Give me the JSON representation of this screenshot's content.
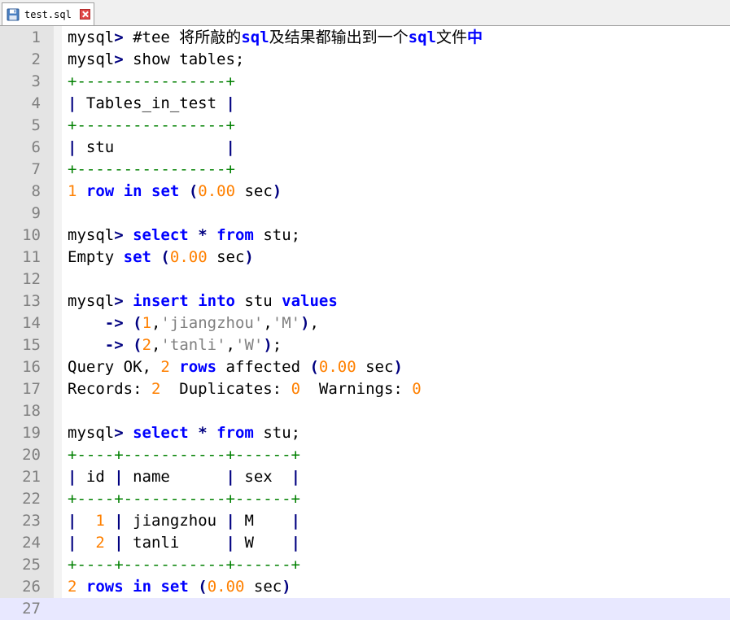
{
  "tab": {
    "filename": "test.sql",
    "icon": "save-disk-icon",
    "close_icon": "close-icon"
  },
  "colors": {
    "keyword": "#0000ff",
    "number": "#ff8000",
    "string": "#808080",
    "border": "#008000",
    "operator": "#000080"
  },
  "editor": {
    "current_line": 27,
    "lines": [
      {
        "n": "1",
        "tokens": [
          {
            "t": "mysql"
          },
          {
            "t": ">",
            "c": "op"
          },
          {
            "t": " #tee "
          },
          {
            "t": "将所敲的",
            "c": "cm"
          },
          {
            "t": "sql",
            "c": "kw"
          },
          {
            "t": "及结果都输出到一个",
            "c": "cm"
          },
          {
            "t": "sql",
            "c": "kw"
          },
          {
            "t": "文件",
            "c": "cm"
          },
          {
            "t": "中",
            "c": "cm kw"
          }
        ]
      },
      {
        "n": "2",
        "tokens": [
          {
            "t": "mysql"
          },
          {
            "t": ">",
            "c": "op"
          },
          {
            "t": " show tables;"
          }
        ]
      },
      {
        "n": "3",
        "tokens": [
          {
            "t": "+----------------+",
            "c": "bd"
          }
        ]
      },
      {
        "n": "4",
        "tokens": [
          {
            "t": "|",
            "c": "op"
          },
          {
            "t": " Tables_in_test "
          },
          {
            "t": "|",
            "c": "op"
          }
        ]
      },
      {
        "n": "5",
        "tokens": [
          {
            "t": "+----------------+",
            "c": "bd"
          }
        ]
      },
      {
        "n": "6",
        "tokens": [
          {
            "t": "|",
            "c": "op"
          },
          {
            "t": " stu            "
          },
          {
            "t": "|",
            "c": "op"
          }
        ]
      },
      {
        "n": "7",
        "tokens": [
          {
            "t": "+----------------+",
            "c": "bd"
          }
        ]
      },
      {
        "n": "8",
        "tokens": [
          {
            "t": "1",
            "c": "num"
          },
          {
            "t": " "
          },
          {
            "t": "row",
            "c": "kw"
          },
          {
            "t": " "
          },
          {
            "t": "in",
            "c": "kw"
          },
          {
            "t": " "
          },
          {
            "t": "set",
            "c": "kw"
          },
          {
            "t": " "
          },
          {
            "t": "(",
            "c": "op"
          },
          {
            "t": "0.00",
            "c": "num"
          },
          {
            "t": " sec"
          },
          {
            "t": ")",
            "c": "op"
          }
        ]
      },
      {
        "n": "9",
        "tokens": []
      },
      {
        "n": "10",
        "tokens": [
          {
            "t": "mysql"
          },
          {
            "t": ">",
            "c": "op"
          },
          {
            "t": " "
          },
          {
            "t": "select",
            "c": "kw"
          },
          {
            "t": " "
          },
          {
            "t": "*",
            "c": "op"
          },
          {
            "t": " "
          },
          {
            "t": "from",
            "c": "kw"
          },
          {
            "t": " stu;"
          }
        ]
      },
      {
        "n": "11",
        "tokens": [
          {
            "t": "Empty "
          },
          {
            "t": "set",
            "c": "kw"
          },
          {
            "t": " "
          },
          {
            "t": "(",
            "c": "op"
          },
          {
            "t": "0.00",
            "c": "num"
          },
          {
            "t": " sec"
          },
          {
            "t": ")",
            "c": "op"
          }
        ]
      },
      {
        "n": "12",
        "tokens": []
      },
      {
        "n": "13",
        "tokens": [
          {
            "t": "mysql"
          },
          {
            "t": ">",
            "c": "op"
          },
          {
            "t": " "
          },
          {
            "t": "insert",
            "c": "kw"
          },
          {
            "t": " "
          },
          {
            "t": "into",
            "c": "kw"
          },
          {
            "t": " stu "
          },
          {
            "t": "values",
            "c": "kw"
          }
        ]
      },
      {
        "n": "14",
        "tokens": [
          {
            "t": "    "
          },
          {
            "t": "->",
            "c": "op"
          },
          {
            "t": " "
          },
          {
            "t": "(",
            "c": "op"
          },
          {
            "t": "1",
            "c": "num"
          },
          {
            "t": ","
          },
          {
            "t": "'jiangzhou'",
            "c": "str"
          },
          {
            "t": ","
          },
          {
            "t": "'M'",
            "c": "str"
          },
          {
            "t": ")",
            "c": "op"
          },
          {
            "t": ","
          }
        ]
      },
      {
        "n": "15",
        "tokens": [
          {
            "t": "    "
          },
          {
            "t": "->",
            "c": "op"
          },
          {
            "t": " "
          },
          {
            "t": "(",
            "c": "op"
          },
          {
            "t": "2",
            "c": "num"
          },
          {
            "t": ","
          },
          {
            "t": "'tanli'",
            "c": "str"
          },
          {
            "t": ","
          },
          {
            "t": "'W'",
            "c": "str"
          },
          {
            "t": ")",
            "c": "op"
          },
          {
            "t": ";"
          }
        ]
      },
      {
        "n": "16",
        "tokens": [
          {
            "t": "Query OK, "
          },
          {
            "t": "2",
            "c": "num"
          },
          {
            "t": " "
          },
          {
            "t": "rows",
            "c": "kw"
          },
          {
            "t": " affected "
          },
          {
            "t": "(",
            "c": "op"
          },
          {
            "t": "0.00",
            "c": "num"
          },
          {
            "t": " sec"
          },
          {
            "t": ")",
            "c": "op"
          }
        ]
      },
      {
        "n": "17",
        "tokens": [
          {
            "t": "Records: "
          },
          {
            "t": "2",
            "c": "num"
          },
          {
            "t": "  Duplicates: "
          },
          {
            "t": "0",
            "c": "num"
          },
          {
            "t": "  Warnings: "
          },
          {
            "t": "0",
            "c": "num"
          }
        ]
      },
      {
        "n": "18",
        "tokens": []
      },
      {
        "n": "19",
        "tokens": [
          {
            "t": "mysql"
          },
          {
            "t": ">",
            "c": "op"
          },
          {
            "t": " "
          },
          {
            "t": "select",
            "c": "kw"
          },
          {
            "t": " "
          },
          {
            "t": "*",
            "c": "op"
          },
          {
            "t": " "
          },
          {
            "t": "from",
            "c": "kw"
          },
          {
            "t": " stu;"
          }
        ]
      },
      {
        "n": "20",
        "tokens": [
          {
            "t": "+----+-----------+------+",
            "c": "bd"
          }
        ]
      },
      {
        "n": "21",
        "tokens": [
          {
            "t": "|",
            "c": "op"
          },
          {
            "t": " id "
          },
          {
            "t": "|",
            "c": "op"
          },
          {
            "t": " name      "
          },
          {
            "t": "|",
            "c": "op"
          },
          {
            "t": " sex  "
          },
          {
            "t": "|",
            "c": "op"
          }
        ]
      },
      {
        "n": "22",
        "tokens": [
          {
            "t": "+----+-----------+------+",
            "c": "bd"
          }
        ]
      },
      {
        "n": "23",
        "tokens": [
          {
            "t": "|",
            "c": "op"
          },
          {
            "t": "  "
          },
          {
            "t": "1",
            "c": "num"
          },
          {
            "t": " "
          },
          {
            "t": "|",
            "c": "op"
          },
          {
            "t": " jiangzhou "
          },
          {
            "t": "|",
            "c": "op"
          },
          {
            "t": " M    "
          },
          {
            "t": "|",
            "c": "op"
          }
        ]
      },
      {
        "n": "24",
        "tokens": [
          {
            "t": "|",
            "c": "op"
          },
          {
            "t": "  "
          },
          {
            "t": "2",
            "c": "num"
          },
          {
            "t": " "
          },
          {
            "t": "|",
            "c": "op"
          },
          {
            "t": " tanli     "
          },
          {
            "t": "|",
            "c": "op"
          },
          {
            "t": " W    "
          },
          {
            "t": "|",
            "c": "op"
          }
        ]
      },
      {
        "n": "25",
        "tokens": [
          {
            "t": "+----+-----------+------+",
            "c": "bd"
          }
        ]
      },
      {
        "n": "26",
        "tokens": [
          {
            "t": "2",
            "c": "num"
          },
          {
            "t": " "
          },
          {
            "t": "rows",
            "c": "kw"
          },
          {
            "t": " "
          },
          {
            "t": "in",
            "c": "kw"
          },
          {
            "t": " "
          },
          {
            "t": "set",
            "c": "kw"
          },
          {
            "t": " "
          },
          {
            "t": "(",
            "c": "op"
          },
          {
            "t": "0.00",
            "c": "num"
          },
          {
            "t": " sec"
          },
          {
            "t": ")",
            "c": "op"
          }
        ]
      },
      {
        "n": "27",
        "tokens": []
      }
    ]
  }
}
